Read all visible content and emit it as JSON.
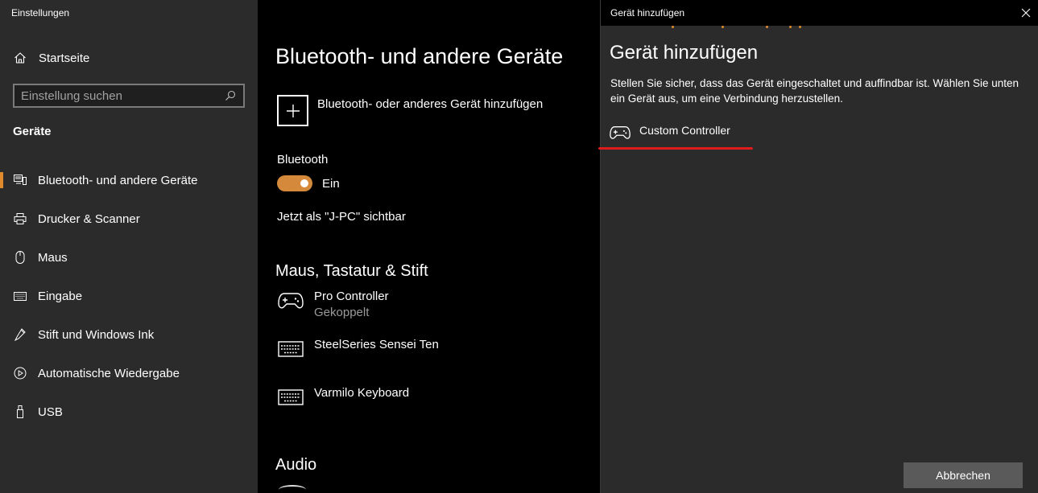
{
  "window": {
    "title": "Einstellungen"
  },
  "sidebar": {
    "home_label": "Startseite",
    "search_placeholder": "Einstellung suchen",
    "section_title": "Geräte",
    "items": [
      {
        "label": "Bluetooth- und andere Geräte",
        "icon": "bluetooth-devices-icon",
        "active": true
      },
      {
        "label": "Drucker & Scanner",
        "icon": "printer-icon"
      },
      {
        "label": "Maus",
        "icon": "mouse-icon"
      },
      {
        "label": "Eingabe",
        "icon": "keyboard-icon"
      },
      {
        "label": "Stift und Windows Ink",
        "icon": "pen-icon"
      },
      {
        "label": "Automatische Wiedergabe",
        "icon": "autoplay-icon"
      },
      {
        "label": "USB",
        "icon": "usb-icon"
      }
    ]
  },
  "main": {
    "title": "Bluetooth- und andere Geräte",
    "add_device_label": "Bluetooth- oder anderes Gerät hinzufügen",
    "bluetooth_label": "Bluetooth",
    "bluetooth_state": "Ein",
    "bluetooth_on": true,
    "visible_as": "Jetzt als \"J-PC\" sichtbar",
    "section_input": "Maus, Tastatur & Stift",
    "devices": [
      {
        "name": "Pro Controller",
        "status": "Gekoppelt",
        "icon": "gamepad-icon"
      },
      {
        "name": "SteelSeries Sensei Ten",
        "status": "",
        "icon": "keyboard-icon"
      },
      {
        "name": "Varmilo Keyboard",
        "status": "",
        "icon": "keyboard-icon"
      }
    ],
    "section_audio": "Audio"
  },
  "dialog": {
    "window_title": "Gerät hinzufügen",
    "heading": "Gerät hinzufügen",
    "description": "Stellen Sie sicher, dass das Gerät eingeschaltet und auffindbar ist. Wählen Sie unten ein Gerät aus, um eine Verbindung herzustellen.",
    "found_device": {
      "name": "Custom Controller",
      "icon": "gamepad-icon"
    },
    "cancel_label": "Abbrechen"
  },
  "colors": {
    "accent": "#e08a2e",
    "toggle_on": "#d48a3a",
    "annotation_red": "#e01b1b",
    "sidebar_bg": "#2b2b2b",
    "main_bg": "#000000"
  }
}
